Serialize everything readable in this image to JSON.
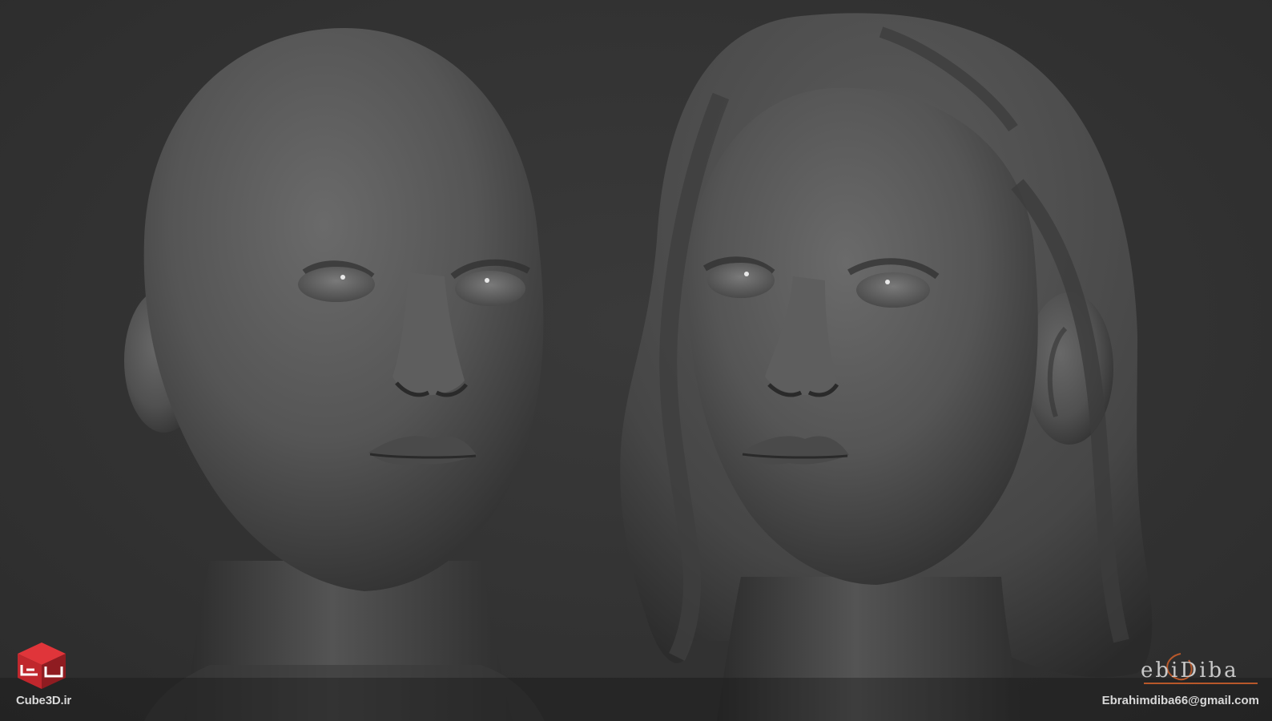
{
  "image": {
    "background_color": "#333333",
    "clay_color": "#5a5a5a",
    "subjects": [
      "bald-head-sculpt",
      "head-with-hair-sculpt"
    ]
  },
  "watermarks": {
    "site": "Cube3D.ir",
    "signature": "ebiDiba",
    "email": "Ebrahimdiba66@gmail.com",
    "logo_color": "#c0272d",
    "signature_accent": "#b8582a"
  }
}
